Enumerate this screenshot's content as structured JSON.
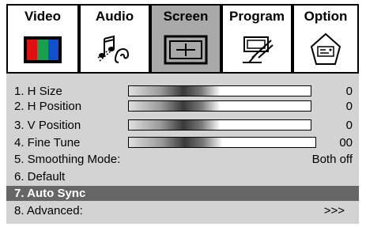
{
  "tabs": [
    {
      "label": "Video",
      "active": false
    },
    {
      "label": "Audio",
      "active": false
    },
    {
      "label": "Screen",
      "active": true
    },
    {
      "label": "Program",
      "active": false
    },
    {
      "label": "Option",
      "active": false
    }
  ],
  "tab_icons": [
    "video-color-bars-icon",
    "audio-note-ear-icon",
    "screen-frame-icon",
    "program-monitor-icon",
    "option-tag-icon"
  ],
  "colors": {
    "active_tab": "#a9a9a9",
    "panel": "#d3d3d3",
    "selected_row": "#666666",
    "red": "#e01010",
    "green": "#18a050",
    "blue": "#1050d0"
  },
  "menu": [
    {
      "label": "1. H Size",
      "value": "0",
      "bar_level": 0.5
    },
    {
      "label": "2. H Position",
      "value": "0",
      "bar_level": 0.5
    },
    {
      "label": "3. V Position",
      "value": "0",
      "bar_level": 0.5
    },
    {
      "label": "4. Fine Tune",
      "value": "00",
      "bar_level": 0.5
    },
    {
      "label": "5. Smoothing Mode:",
      "value": "Both off"
    },
    {
      "label": "6. Default",
      "value": ""
    },
    {
      "label": "7. Auto Sync",
      "value": "",
      "selected": true
    },
    {
      "label": "8. Advanced:",
      "value": ">>>"
    }
  ]
}
